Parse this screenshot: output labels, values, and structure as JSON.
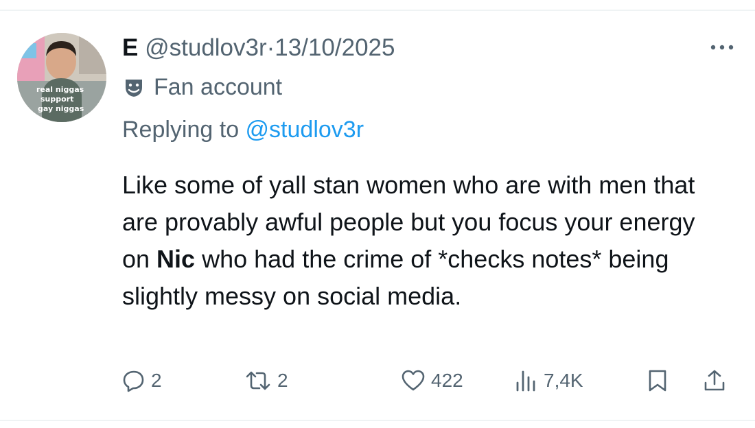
{
  "tweet": {
    "author": {
      "display_name": "E",
      "handle": "@studlov3r",
      "avatar_caption": [
        "real niggas",
        "support",
        "gay niggas"
      ]
    },
    "separator": "·",
    "date": "13/10/2025",
    "label": "Fan account",
    "replying_prefix": "Replying to ",
    "replying_handle": "@studlov3r",
    "text_before": "Like some of yall stan women who are with men that are provably awful people but you focus your energy on ",
    "text_bold": "Nic",
    "text_after": " who had the crime of *checks notes* being slightly messy on social media."
  },
  "actions": {
    "replies": "2",
    "reposts": "2",
    "likes": "422",
    "views": "7,4K"
  },
  "colors": {
    "text": "#0f1419",
    "muted": "#536471",
    "link": "#1d9bf0",
    "divider": "#eff3f4"
  },
  "icons": [
    "more-icon",
    "fan-account-icon",
    "reply-icon",
    "repost-icon",
    "like-icon",
    "views-icon",
    "bookmark-icon",
    "share-icon"
  ]
}
